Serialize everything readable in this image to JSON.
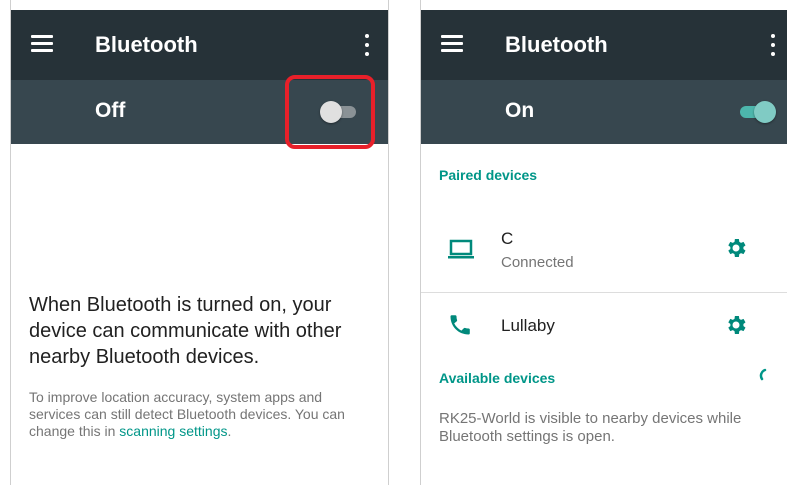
{
  "left_screen": {
    "title": "Bluetooth",
    "switch_label": "Off",
    "toggle_state": "off",
    "description": "When Bluetooth is turned on, your device can communicate with other nearby Bluetooth devices.",
    "note_prefix": "To improve location accuracy, system apps and services can still detect Bluetooth devices. You can change this in ",
    "note_link": "scanning settings",
    "note_suffix": "."
  },
  "right_screen": {
    "title": "Bluetooth",
    "switch_label": "On",
    "toggle_state": "on",
    "paired_header": "Paired devices",
    "paired_devices": [
      {
        "name": "C",
        "status": "Connected",
        "icon": "laptop-icon"
      },
      {
        "name": "Lullaby",
        "status": "",
        "icon": "phone-icon"
      }
    ],
    "available_header": "Available devices",
    "visible_note": "RK25-World is visible to nearby devices while Bluetooth settings is open."
  },
  "colors": {
    "toolbar": "#263238",
    "switchbar": "#37474f",
    "accent": "#009688",
    "toggle_on_thumb": "#80cbc4",
    "highlight": "#e8202a"
  }
}
